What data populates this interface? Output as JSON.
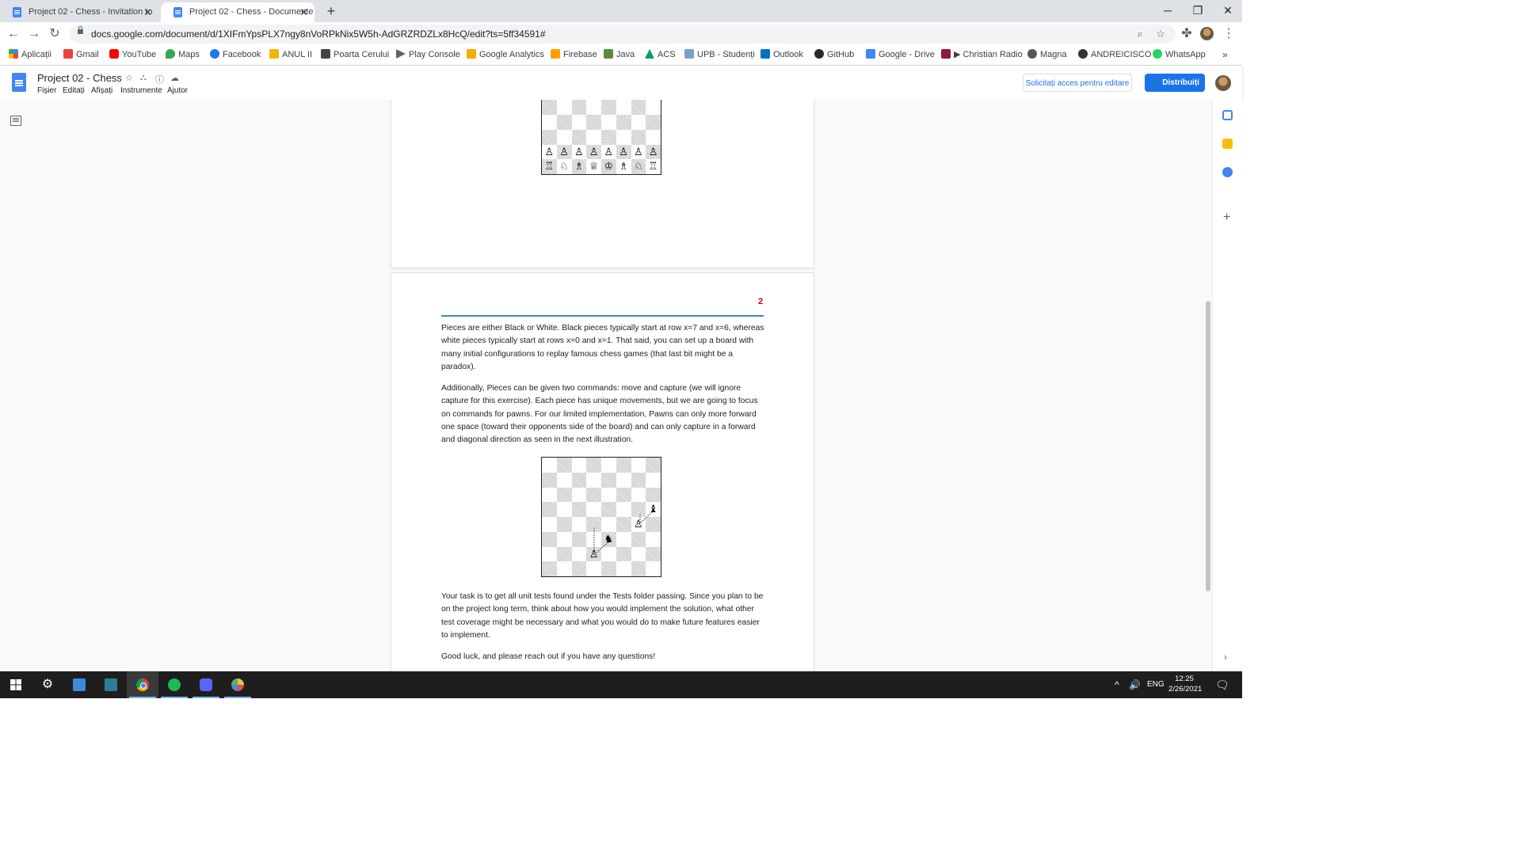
{
  "browser": {
    "tabs": [
      {
        "title": "Project 02 - Chess - Invitation to"
      },
      {
        "title": "Project 02 - Chess - Documente"
      }
    ],
    "url": "docs.google.com/document/d/1XIFmYpsPLX7ngy8nVoRPkNix5W5h-AdGRZRDZLx8HcQ/edit?ts=5ff34591#",
    "bookmarks": [
      "Aplicații",
      "Gmail",
      "YouTube",
      "Maps",
      "Facebook",
      "ANUL II",
      "Poarta Cerului",
      "Play Console",
      "Google Analytics",
      "Firebase",
      "Java",
      "ACS",
      "UPB - Studenți",
      "Outlook",
      "GitHub",
      "Google - Drive",
      "▶ Christian Radio",
      "Magna",
      "ANDREICISCO",
      "WhatsApp"
    ]
  },
  "docs": {
    "title": "Project 02 - Chess",
    "menu": [
      "Fișier",
      "Editați",
      "Afișați",
      "Instrumente",
      "Ajutor"
    ],
    "request_access": "Solicitați acces pentru editare",
    "share": "Distribuiți"
  },
  "document": {
    "page_number": "2",
    "paragraphs": [
      "Pieces are either Black or White. Black pieces typically start at row x=7 and x=6, whereas white pieces typically start at rows x=0 and x=1. That said, you can set up a board with many initial configurations to replay famous chess games (that last bit might be a paradox).",
      "Additionally, Pieces can be given two commands: move and capture (we will ignore capture for this exercise). Each piece has unique movements, but we are going to focus on commands for pawns. For our limited implementation, Pawns can only more forward one space (toward their opponents side of the board) and can only capture in a forward and diagonal direction as seen in the next illustration.",
      "Your task is to get all unit tests found under the Tests folder passing. Since you plan to be on the project long term, think about how you would implement the solution, what other test coverage might be necessary and what you would do to make future features easier to implement.",
      "Good luck, and please reach out if you have any questions!"
    ],
    "board1": [
      [
        "♜",
        "♞",
        "♝",
        "♛",
        "♚",
        "♝",
        "♞",
        "♜"
      ],
      [
        "♟",
        "♟",
        "♟",
        "♟",
        "♟",
        "♟",
        "♟",
        "♟"
      ],
      [
        "",
        "",
        "",
        "",
        "",
        "",
        "",
        ""
      ],
      [
        "",
        "",
        "",
        "",
        "",
        "",
        "",
        ""
      ],
      [
        "",
        "",
        "",
        "",
        "",
        "",
        "",
        ""
      ],
      [
        "",
        "",
        "",
        "",
        "",
        "",
        "",
        ""
      ],
      [
        "♙",
        "♙",
        "♙",
        "♙",
        "♙",
        "♙",
        "♙",
        "♙"
      ],
      [
        "♖",
        "♘",
        "♗",
        "♕",
        "♔",
        "♗",
        "♘",
        "♖"
      ]
    ],
    "board2": [
      [
        "",
        "",
        "",
        "",
        "",
        "",
        "",
        ""
      ],
      [
        "",
        "",
        "",
        "",
        "",
        "",
        "",
        ""
      ],
      [
        "",
        "",
        "",
        "",
        "",
        "",
        "",
        ""
      ],
      [
        "",
        "",
        "",
        "",
        "",
        "",
        "",
        "♝"
      ],
      [
        "",
        "",
        "",
        "",
        "",
        "",
        "♙",
        ""
      ],
      [
        "",
        "",
        "",
        "",
        "♞",
        "",
        "",
        ""
      ],
      [
        "",
        "",
        "",
        "♙",
        "",
        "",
        "",
        ""
      ],
      [
        "",
        "",
        "",
        "",
        "",
        "",
        "",
        ""
      ]
    ]
  },
  "taskbar": {
    "language": "ENG",
    "time": "12:25",
    "date": "2/26/2021"
  },
  "colors": {
    "accent": "#1a73e8",
    "page_number": "#cc0000",
    "header_rule": "#3d85c6"
  }
}
